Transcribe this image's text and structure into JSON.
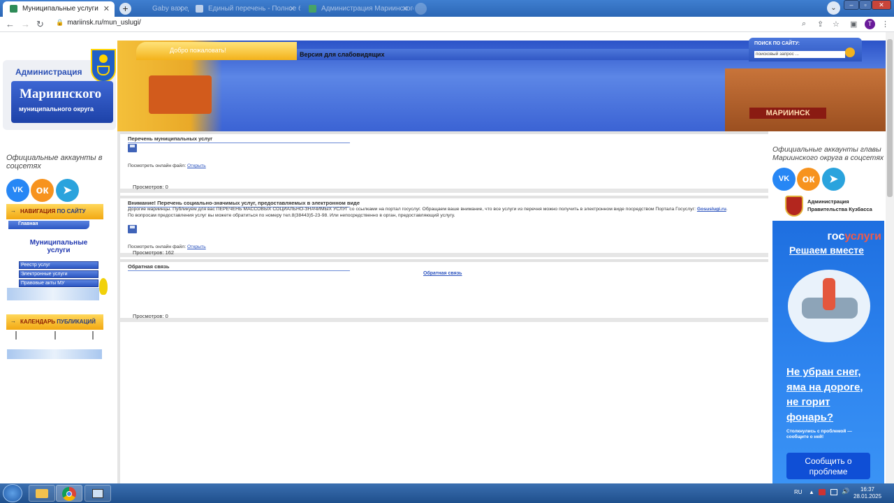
{
  "browser": {
    "tabs": [
      {
        "title": "Муниципальные услуги",
        "active": true
      },
      {
        "title": "Gaby ва редакто...",
        "active": false
      },
      {
        "title": "Единый перечень - Полное бе...",
        "active": false
      },
      {
        "title": "Администрация Мариинского...",
        "active": false
      }
    ],
    "new_tab_label": "+",
    "url": "mariinsk.ru/mun_uslugi/",
    "profile_initial": "T"
  },
  "header": {
    "logo_line1": "Администрация",
    "logo_line2": "Мариинского",
    "logo_line3": "муниципального округа",
    "welcome": "Добро пожаловать!",
    "a11y_prefix": "Версия для",
    "a11y_suffix": "слабовидящих",
    "search_label": "ПОИСК ПО САЙТУ:",
    "search_placeholder": "поисковый запрос ...",
    "banner_sign": "МАРИИНСК"
  },
  "left": {
    "social_title": "Официальные аккаунты в соцсетях",
    "nav_title_a": "НАВИГАЦИЯ",
    "nav_title_b": "ПО САЙТУ",
    "home": "Главная",
    "section_title": "Муниципальные услуги",
    "items": [
      "Реестр услуг",
      "Электронные услуги",
      "Правовые акты МУ"
    ],
    "calendar_a": "КАЛЕНДАРЬ",
    "calendar_b": "ПУБЛИКАЦИЙ"
  },
  "content": {
    "box1": {
      "title": "Перечень муниципальных услуг",
      "view_file": "Посмотреть онлайн файл:",
      "open": "Открыть",
      "views": "Просмотров: 0"
    },
    "box2": {
      "title": "Внимание! Перечень социально-значимых услуг, предоставляемых в электронном виде",
      "line1": "Дорогие мариинцы. Публикуем для вас ПЕРЕЧЕНЬ МАССОВЫХ СОЦИАЛЬНО-ЗНАЧИМЫХ УСЛУГ со ссылками на портал госуслуг. Обращаем ваше внимание, что все услуги из перечня можно получить в электронном виде посредством Портала Госуслуг:",
      "link": "Gosuslugi.ru",
      "line3": "По вопросам предоставления услуг вы можете обратиться по номеру тел.8(38443)5-23-98. Или непосредственно в орган, предоставляющий услугу.",
      "view_file": "Посмотреть онлайн файл:",
      "open": "Открыть",
      "views": "Просмотров: 162"
    },
    "box3": {
      "title": "Обратная связь",
      "link": "Обратная связь",
      "views": "Просмотров: 0"
    }
  },
  "right": {
    "social_title": "Официальные аккаунты главы Мариинского округа в соцсетях",
    "gov_line1": "Администрация",
    "gov_line2": "Правительства Кузбасса",
    "gos_brand_a": "гос",
    "gos_brand_b": "услуги",
    "gos_slogan": "Решаем вместе",
    "gos_q1": "Не убран снег,",
    "gos_q2": "яма на дороге,",
    "gos_q3": "не горит",
    "gos_q4": "фонарь?",
    "gos_small": "Столкнулись с проблемой — сообщите о ней!",
    "gos_button": "Сообщить о проблеме"
  },
  "taskbar": {
    "lang": "RU",
    "time": "16:37",
    "date": "28.01.2025"
  },
  "colors": {
    "accent": "#2a52be",
    "gos_blue": "#1e6fe0",
    "orange": "#f2a812"
  }
}
